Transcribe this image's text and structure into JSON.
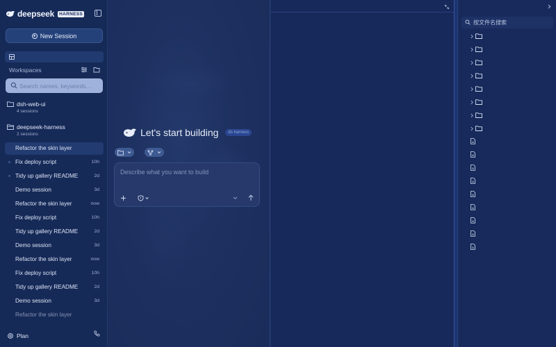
{
  "brand": {
    "name": "deepseek",
    "badge": "HARNESS"
  },
  "sidebar": {
    "new_session_label": "New Session",
    "workspaces_label": "Workspaces",
    "search_placeholder": "Search names, keywords...",
    "workspaces": [
      {
        "name": "dsh-web-ui",
        "count": "4 sessions"
      },
      {
        "name": "deepseek-harness",
        "count": "2 sessions"
      }
    ],
    "sessions": [
      {
        "label": "Refactor the skin layer",
        "time": "",
        "active": true
      },
      {
        "label": "Fix deploy script",
        "time": "10h"
      },
      {
        "label": "Tidy up gallery README",
        "time": "2d"
      },
      {
        "label": "Demo session",
        "time": "3d"
      },
      {
        "label": "Refactor the skin layer",
        "time": "now"
      },
      {
        "label": "Fix deploy script",
        "time": "10h"
      },
      {
        "label": "Tidy up gallery README",
        "time": "2d"
      },
      {
        "label": "Demo session",
        "time": "3d"
      },
      {
        "label": "Refactor the skin layer",
        "time": "now"
      },
      {
        "label": "Fix deploy script",
        "time": "10h"
      },
      {
        "label": "Tidy up gallery README",
        "time": "2d"
      },
      {
        "label": "Demo session",
        "time": "3d"
      },
      {
        "label": "Refactor the skin layer",
        "time": ""
      }
    ],
    "footer": {
      "plan_label": "Plan"
    }
  },
  "main": {
    "welcome_title": "Let's start building",
    "welcome_tag": "ds·harness",
    "composer_placeholder": "Describe what you want to build"
  },
  "files": {
    "search_placeholder": "按文件名搜索",
    "folder_count": 8,
    "file_count": 9
  },
  "colors": {
    "background": "#1a2d5c",
    "sidebar": "#162a58",
    "accent": "#24417a",
    "search_field": "#9fb2dc",
    "text": "#dfe6f6"
  }
}
